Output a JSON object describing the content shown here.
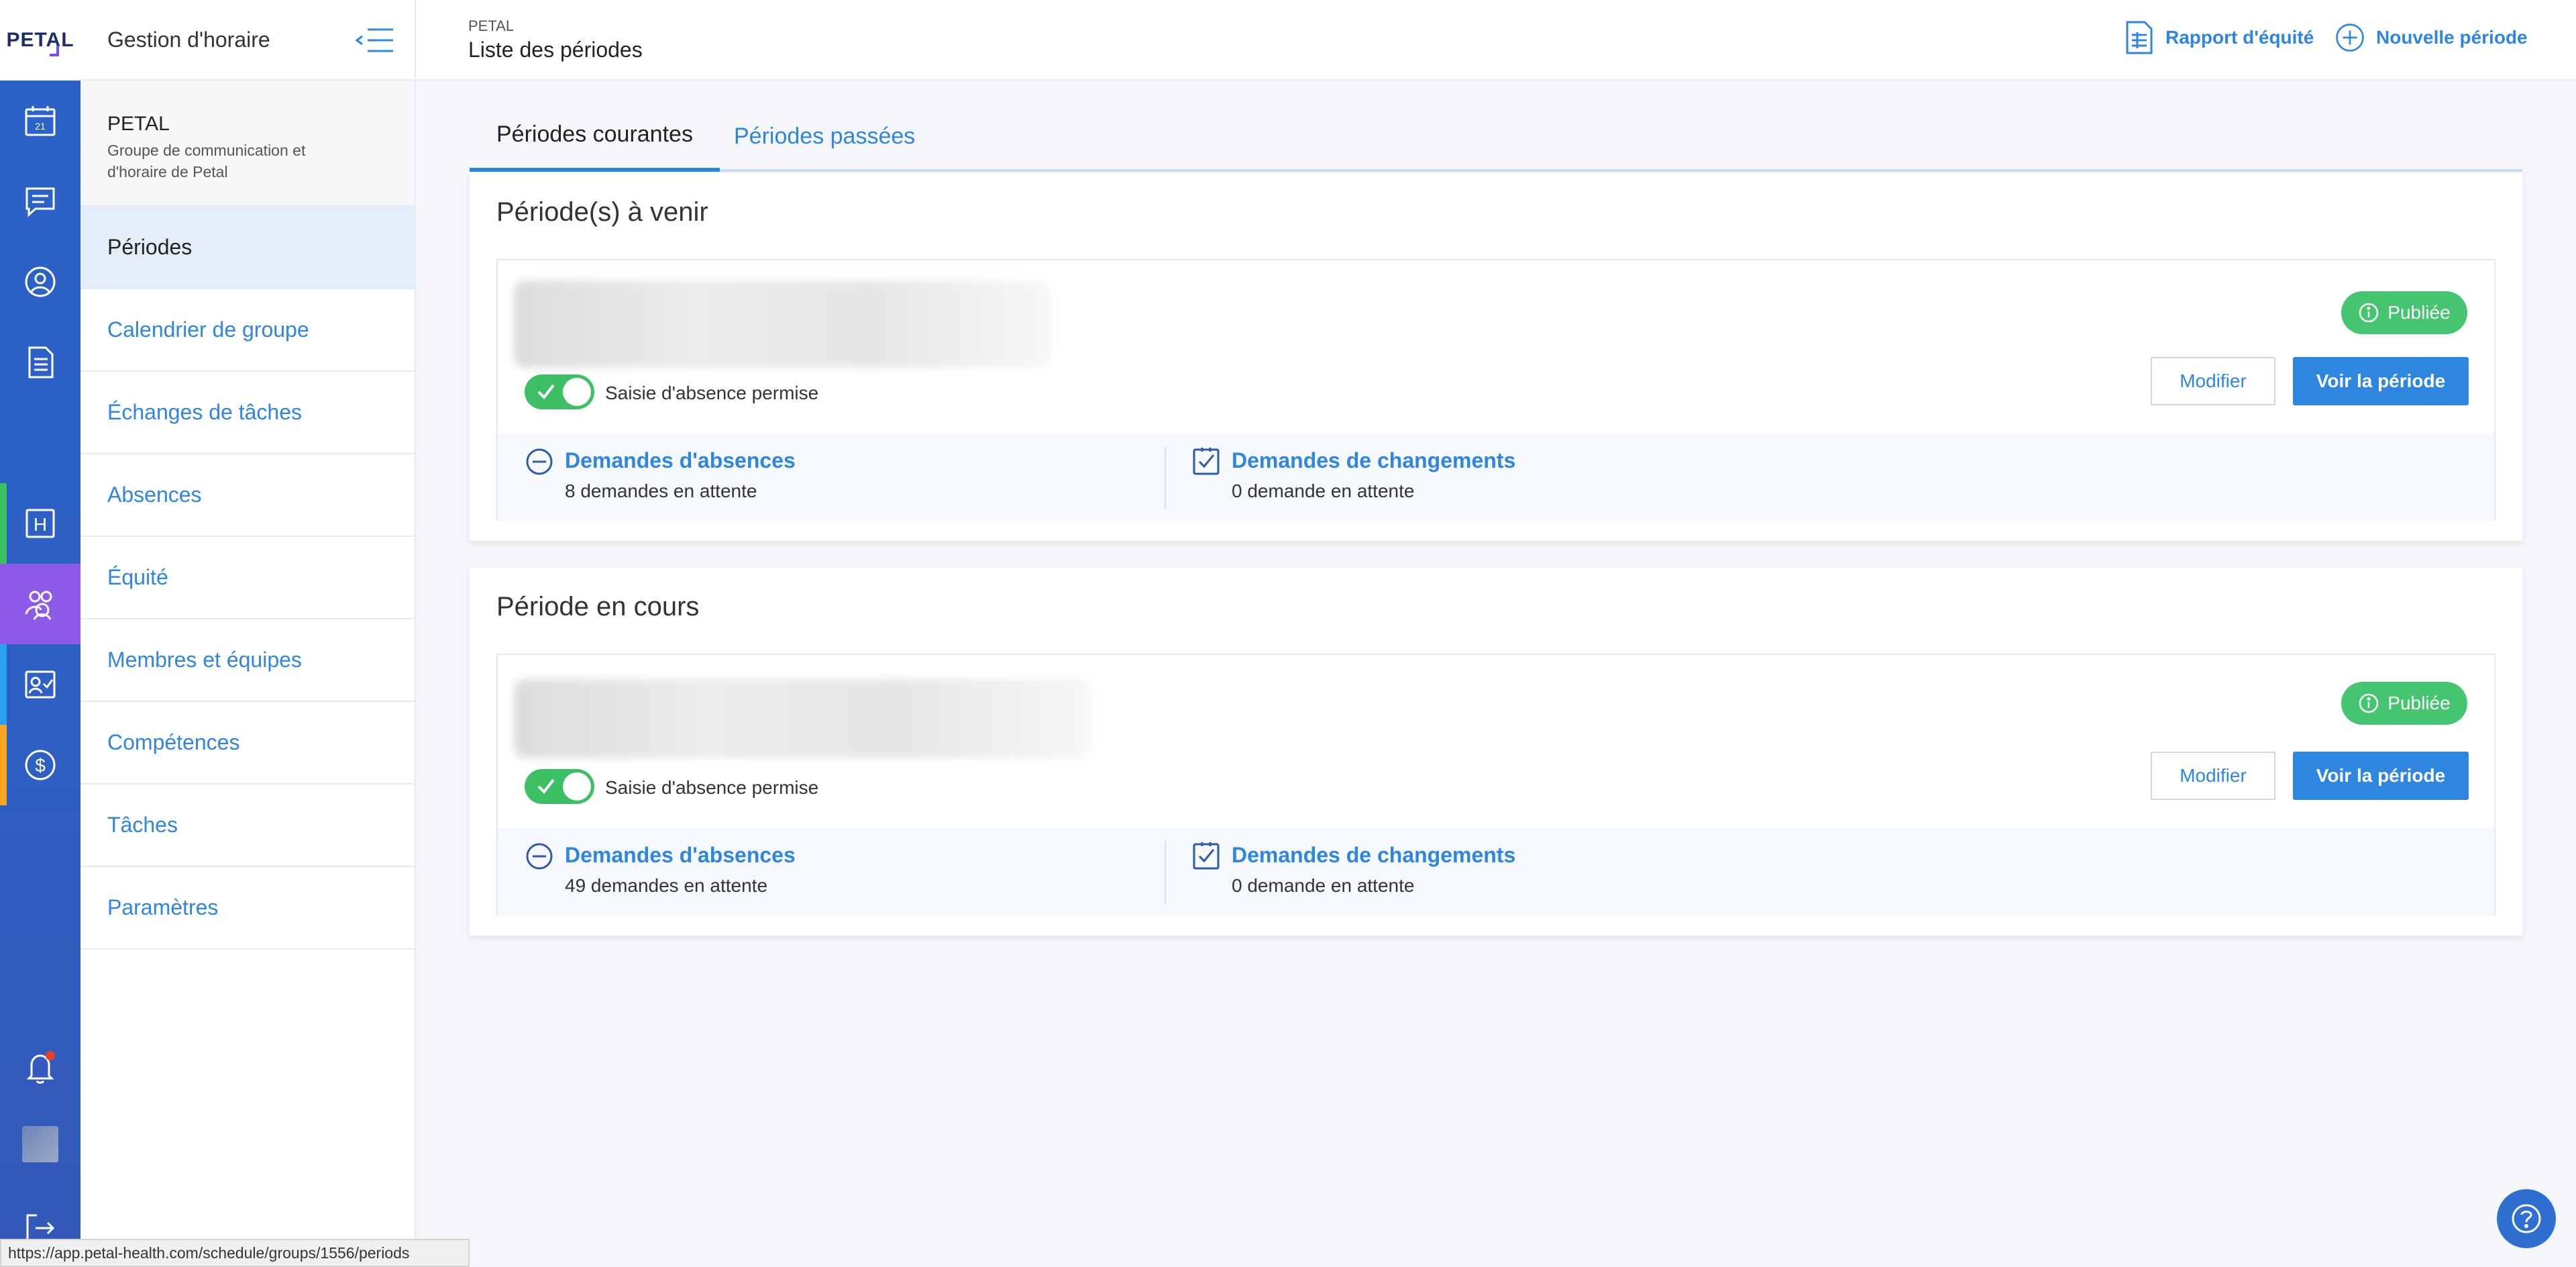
{
  "app": {
    "logo": "PETAL"
  },
  "rail": {
    "items": [
      {
        "name": "calendar-icon",
        "label": "21"
      },
      {
        "name": "chat-icon"
      },
      {
        "name": "profile-icon"
      },
      {
        "name": "document-icon"
      },
      {
        "name": "hospital-icon",
        "label": "H",
        "stripe": "#3cc063"
      },
      {
        "name": "group-icon",
        "active": true
      },
      {
        "name": "badge-icon",
        "stripe": "#29a3f2"
      },
      {
        "name": "dollar-icon",
        "label": "$",
        "stripe": "#f5a623"
      }
    ],
    "bottom": [
      "bell-icon",
      "avatar",
      "logout-icon"
    ]
  },
  "nav": {
    "title": "Gestion d'horaire",
    "org_name": "PETAL",
    "org_desc": "Groupe de communication et d'horaire de Petal",
    "items": [
      {
        "label": "Périodes",
        "active": true
      },
      {
        "label": "Calendrier de groupe"
      },
      {
        "label": "Échanges de tâches"
      },
      {
        "label": "Absences"
      },
      {
        "label": "Équité"
      },
      {
        "label": "Membres et équipes"
      },
      {
        "label": "Compétences"
      },
      {
        "label": "Tâches"
      },
      {
        "label": "Paramètres"
      }
    ]
  },
  "topbar": {
    "breadcrumb": "PETAL",
    "title": "Liste des périodes",
    "equity_report": "Rapport d'équité",
    "new_period": "Nouvelle période"
  },
  "tabs": [
    {
      "label": "Périodes courantes",
      "active": true
    },
    {
      "label": "Périodes passées",
      "active": false
    }
  ],
  "sections": [
    {
      "title": "Période(s) à venir",
      "period": {
        "toggle_label": "Saisie d'absence permise",
        "toggle_on": true,
        "status": "Publiée",
        "edit_label": "Modifier",
        "view_label": "Voir la période",
        "absence_title": "Demandes d'absences",
        "absence_count": "8 demandes en attente",
        "change_title": "Demandes de changements",
        "change_count": "0 demande en attente"
      }
    },
    {
      "title": "Période en cours",
      "period": {
        "toggle_label": "Saisie d'absence permise",
        "toggle_on": true,
        "status": "Publiée",
        "edit_label": "Modifier",
        "view_label": "Voir la période",
        "absence_title": "Demandes d'absences",
        "absence_count": "49 demandes en attente",
        "change_title": "Demandes de changements",
        "change_count": "0 demande en attente"
      }
    }
  ],
  "colors": {
    "accent": "#2f86de",
    "rail": "#2a62c9",
    "rail_active": "#8d5be8",
    "success": "#45c56f",
    "notification": "#e8402a"
  },
  "statusbar": {
    "url": "https://app.petal-health.com/schedule/groups/1556/periods"
  }
}
